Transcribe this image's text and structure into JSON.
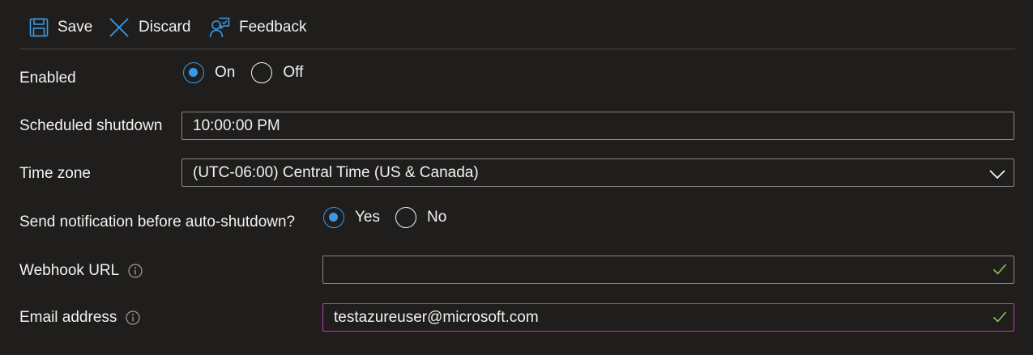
{
  "toolbar": {
    "save_label": "Save",
    "discard_label": "Discard",
    "feedback_label": "Feedback"
  },
  "form": {
    "enabled": {
      "label": "Enabled",
      "options": [
        "On",
        "Off"
      ],
      "selected": "On"
    },
    "scheduled_shutdown": {
      "label": "Scheduled shutdown",
      "value": "10:00:00 PM"
    },
    "time_zone": {
      "label": "Time zone",
      "value": "(UTC-06:00) Central Time (US & Canada)"
    },
    "send_notification": {
      "label": "Send notification before auto-shutdown?",
      "options": [
        "Yes",
        "No"
      ],
      "selected": "Yes"
    },
    "webhook_url": {
      "label": "Webhook URL",
      "value": ""
    },
    "email_address": {
      "label": "Email address",
      "value": "testazureuser@microsoft.com"
    }
  },
  "colors": {
    "accent": "#3899e8",
    "valid_check": "#92c353",
    "focus_border": "#c239b3",
    "background": "#1f1e1d"
  },
  "icons": [
    "save-icon",
    "discard-icon",
    "feedback-icon",
    "info-icon",
    "chevron-down-icon",
    "checkmark-icon"
  ]
}
